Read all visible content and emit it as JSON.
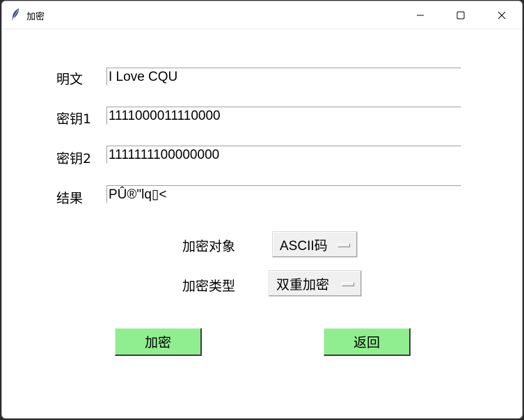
{
  "window": {
    "title": "加密"
  },
  "fields": [
    {
      "label": "明文",
      "value": "I Love CQU"
    },
    {
      "label": "密钥1",
      "value": "1111000011110000"
    },
    {
      "label": "密钥2",
      "value": "1111111100000000"
    },
    {
      "label": "结果",
      "value": "PÛ®\"lq▯<"
    }
  ],
  "options": {
    "encrypt_object_label": "加密对象",
    "encrypt_object_value": "ASCII码",
    "encrypt_type_label": "加密类型",
    "encrypt_type_value": "双重加密"
  },
  "buttons": {
    "encrypt": "加密",
    "back": "返回",
    "button_color": "#90ee90"
  },
  "icons": {
    "app": "feather-icon",
    "minimize": "minimize-icon",
    "maximize": "maximize-icon",
    "close": "close-icon"
  }
}
